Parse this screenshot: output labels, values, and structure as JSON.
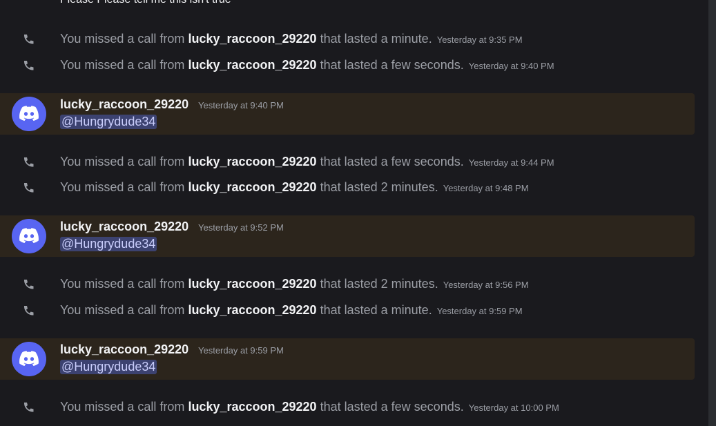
{
  "previous_message": "Please Please tell me this isn't true",
  "items": [
    {
      "type": "call",
      "prefix": "You missed a call from",
      "caller": "lucky_raccoon_29220",
      "suffix": "that lasted a minute.",
      "time": "Yesterday at 9:35 PM"
    },
    {
      "type": "call",
      "prefix": "You missed a call from",
      "caller": "lucky_raccoon_29220",
      "suffix": "that lasted a few seconds.",
      "time": "Yesterday at 9:40 PM"
    },
    {
      "type": "message",
      "author": "lucky_raccoon_29220",
      "time": "Yesterday at 9:40 PM",
      "mention": "@Hungrydude34"
    },
    {
      "type": "call",
      "prefix": "You missed a call from",
      "caller": "lucky_raccoon_29220",
      "suffix": "that lasted a few seconds.",
      "time": "Yesterday at 9:44 PM"
    },
    {
      "type": "call",
      "prefix": "You missed a call from",
      "caller": "lucky_raccoon_29220",
      "suffix": "that lasted 2 minutes.",
      "time": "Yesterday at 9:48 PM"
    },
    {
      "type": "message",
      "author": "lucky_raccoon_29220",
      "time": "Yesterday at 9:52 PM",
      "mention": "@Hungrydude34"
    },
    {
      "type": "call",
      "prefix": "You missed a call from",
      "caller": "lucky_raccoon_29220",
      "suffix": "that lasted 2 minutes.",
      "time": "Yesterday at 9:56 PM"
    },
    {
      "type": "call",
      "prefix": "You missed a call from",
      "caller": "lucky_raccoon_29220",
      "suffix": "that lasted a minute.",
      "time": "Yesterday at 9:59 PM"
    },
    {
      "type": "message",
      "author": "lucky_raccoon_29220",
      "time": "Yesterday at 9:59 PM",
      "mention": "@Hungrydude34"
    },
    {
      "type": "call",
      "prefix": "You missed a call from",
      "caller": "lucky_raccoon_29220",
      "suffix": "that lasted a few seconds.",
      "time": "Yesterday at 10:00 PM"
    }
  ],
  "colors": {
    "mention_highlight": "#2c251c",
    "avatar": "#5865f2",
    "mention_bg": "#3c4270"
  },
  "icons": {
    "call": "phone-missed-icon",
    "avatar": "discord-logo-icon"
  }
}
